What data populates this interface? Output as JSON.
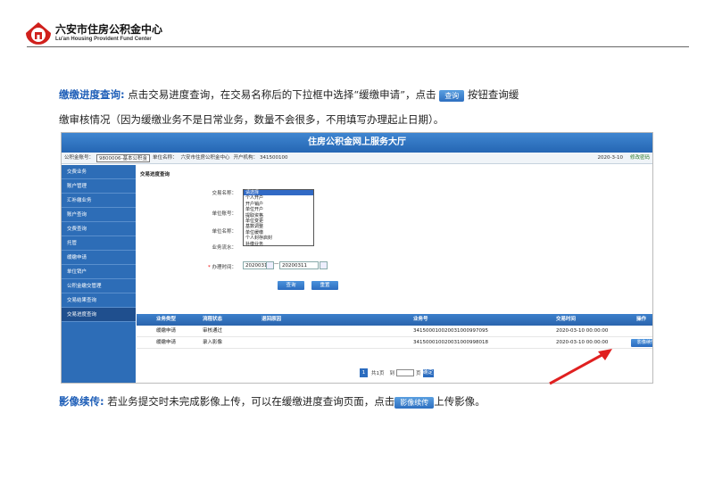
{
  "header": {
    "org_name": "六安市住房公积金中心",
    "org_name_en": "Lu'an Housing Provident Fund Center"
  },
  "para1": {
    "highlight": "缴缴进度查询:",
    "text_a": " 点击交易进度查询，在交易名称后的下拉框中选择“缓缴申请”，点击",
    "button": "查询",
    "text_b": " 按钮查询缓",
    "line2": "缴审核情况（因为缓缴业务不是日常业务，数量不会很多，不用填写办理起止日期）。"
  },
  "para2": {
    "highlight": "影像续传:",
    "text_a": " 若业务提交时未完成影像上传，可以在缓缴进度查询页面，点击",
    "button": "影像续传",
    "text_b": "上传影像。"
  },
  "screenshot": {
    "title": "住房公积金网上服务大厅",
    "infobar": {
      "account_label": "公积金账号：",
      "account_value": "9800006-基本公积金",
      "unit_label": "单位名称：",
      "unit_value": "六安市住房公积金中心",
      "bank_label": "开户机构：",
      "bank_value": "341500100",
      "date": "2020-3-10",
      "password": "修改密码"
    },
    "sidebar": [
      {
        "label": "交费业务"
      },
      {
        "label": "账户管理"
      },
      {
        "label": "汇补缴业务"
      },
      {
        "label": "账户查询"
      },
      {
        "label": "交费查询"
      },
      {
        "label": "托管"
      },
      {
        "label": "缓缴申请"
      },
      {
        "label": "单位销户"
      },
      {
        "label": "公积金缴交管理"
      },
      {
        "label": "交易结果查询"
      },
      {
        "label": "交易进度查询"
      }
    ],
    "section_title": "交易进度查询",
    "form": {
      "trade_name_label": "交易名称：",
      "unit_no_label": "单位账号：",
      "unit_name_label": "单位名称：",
      "biz_no_label": "业务流水：",
      "date_label": "办理时间：",
      "date_from": "20200310",
      "date_to": "20200311",
      "date_sep": "—",
      "dropdown_options": [
        "请选择",
        "个人开户",
        "开户销户",
        "单位开户",
        "提取资格",
        "单位变更",
        "基数调整",
        "单位缓缴",
        "个人封存启封",
        "补缴业务",
        "缓缴申请"
      ],
      "query_button": "查询",
      "reset_button": "重置"
    },
    "table": {
      "headers": [
        "业务类型",
        "流程状态",
        "退回原因",
        "业务号",
        "交易时间",
        "操作"
      ],
      "rows": [
        {
          "type": "缓缴申请",
          "status": "审核通过",
          "reason": "",
          "no": "341500010020031000997095",
          "time": "2020-03-10 00:00:00",
          "op": ""
        },
        {
          "type": "缓缴申请",
          "status": "录入影像",
          "reason": "",
          "no": "341500010020031000998018",
          "time": "2020-03-10 00:00:00",
          "op": "影像续传"
        }
      ]
    },
    "pager": {
      "current": "1",
      "total_text": "共1页",
      "goto_label": "到",
      "page_unit": "页",
      "go_button": "确定"
    }
  },
  "colors": {
    "accent_blue": "#2d6db7",
    "highlight_text": "#1f5fb8",
    "arrow_red": "#e02020"
  }
}
